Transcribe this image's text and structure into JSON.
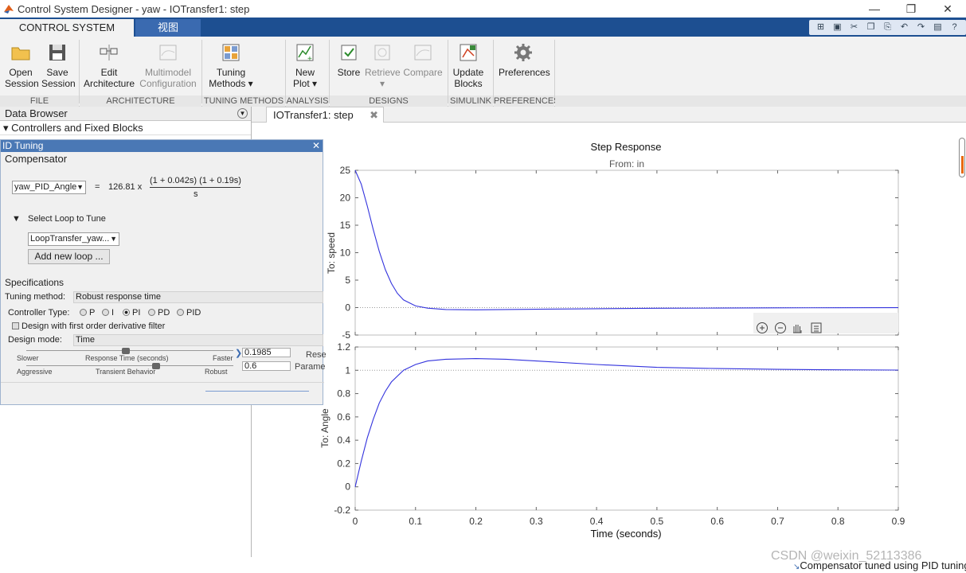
{
  "window": {
    "title": "Control System Designer - yaw - IOTransfer1: step",
    "controls": [
      "—",
      "❐",
      "✕"
    ]
  },
  "tabs": {
    "active": "CONTROL SYSTEM",
    "inactive": "视图"
  },
  "quick_access": [
    "⊞",
    "▣",
    "✂",
    "❐",
    "⎘",
    "↶",
    "↷",
    "▤",
    "?"
  ],
  "ribbon": {
    "open_session": "Open\nSession",
    "save_session": "Save\nSession",
    "edit_architecture": "Edit\nArchitecture",
    "multimodel_configuration": "Multimodel\nConfiguration",
    "tuning_methods": "Tuning\nMethods ▾",
    "new_plot": "New\nPlot ▾",
    "store": "Store",
    "retrieve": "Retrieve\n▾",
    "compare": "Compare",
    "update_blocks": "Update\nBlocks",
    "preferences": "Preferences",
    "groups": [
      "FILE",
      "ARCHITECTURE",
      "TUNING METHODS",
      "ANALYSIS",
      "DESIGNS",
      "SIMULINK",
      "PREFERENCES"
    ]
  },
  "data_browser": {
    "header": "Data Browser",
    "section": "▾ Controllers and Fixed Blocks"
  },
  "document_tab": {
    "label": "IOTransfer1: step",
    "close": "✖"
  },
  "pid_panel": {
    "title": "ID Tuning",
    "compensator_label": "Compensator",
    "compensator_select": "yaw_PID_Angle",
    "equals": "=",
    "gain": "126.81 x",
    "numerator": "(1 + 0.042s) (1 + 0.19s)",
    "denominator": "s",
    "select_loop_label": "Select Loop to Tune",
    "loop_select": "LoopTransfer_yaw...",
    "add_loop_button": "Add new loop ...",
    "specifications_label": "Specifications",
    "tuning_method_label": "Tuning method:",
    "tuning_method_value": "Robust response time",
    "controller_type_label": "Controller Type:",
    "controller_types": [
      {
        "label": "P",
        "selected": false
      },
      {
        "label": "I",
        "selected": false
      },
      {
        "label": "PI",
        "selected": true
      },
      {
        "label": "PD",
        "selected": false
      },
      {
        "label": "PID",
        "selected": false
      }
    ],
    "derivative_filter_label": "Design with first order derivative filter",
    "design_mode_label": "Design mode:",
    "design_mode_value": "Time",
    "slider1": {
      "left": "Slower",
      "mid": "Response Time (seconds)",
      "right": "Faster",
      "value": "0.1985"
    },
    "slider2": {
      "left": "Aggressive",
      "mid": "Transient Behavior",
      "right": "Robust",
      "value": "0.6"
    },
    "reset_label": "Rese",
    "param_label": "Parame"
  },
  "plot": {
    "title": "Step Response",
    "subtitle": "From: in",
    "xlabel": "Time (seconds)",
    "top_ylabel": "To: speed",
    "bottom_ylabel": "To: Angle",
    "plot_toolbar_icons": [
      "zoom-in",
      "zoom-out",
      "pan",
      "legend"
    ]
  },
  "chart_data": [
    {
      "type": "line",
      "title": "Step Response",
      "subtitle": "From: in",
      "ylabel": "To: speed",
      "xlabel": "",
      "x_ticks": [
        0,
        0.1,
        0.2,
        0.3,
        0.4,
        0.5,
        0.6,
        0.7,
        0.8,
        0.9
      ],
      "y_ticks": [
        -5,
        0,
        5,
        10,
        15,
        20,
        25
      ],
      "xlim": [
        0,
        0.9
      ],
      "ylim": [
        -5,
        25
      ],
      "reference_line": 0,
      "x": [
        0,
        0.01,
        0.02,
        0.03,
        0.04,
        0.05,
        0.06,
        0.07,
        0.08,
        0.1,
        0.12,
        0.15,
        0.2,
        0.3,
        0.4,
        0.5,
        0.6,
        0.7,
        0.8,
        0.9
      ],
      "y": [
        25,
        22.5,
        18.5,
        14.2,
        10.2,
        6.9,
        4.4,
        2.6,
        1.4,
        0.3,
        -0.1,
        -0.35,
        -0.4,
        -0.3,
        -0.2,
        -0.12,
        -0.08,
        -0.05,
        -0.03,
        -0.02
      ]
    },
    {
      "type": "line",
      "ylabel": "To: Angle",
      "xlabel": "Time (seconds)",
      "x_ticks": [
        0,
        0.1,
        0.2,
        0.3,
        0.4,
        0.5,
        0.6,
        0.7,
        0.8,
        0.9
      ],
      "y_ticks": [
        -0.2,
        0,
        0.2,
        0.4,
        0.6,
        0.8,
        1,
        1.2
      ],
      "xlim": [
        0,
        0.9
      ],
      "ylim": [
        -0.2,
        1.2
      ],
      "reference_line": 1,
      "x": [
        0,
        0.01,
        0.02,
        0.03,
        0.04,
        0.05,
        0.06,
        0.08,
        0.1,
        0.12,
        0.15,
        0.2,
        0.25,
        0.3,
        0.4,
        0.5,
        0.6,
        0.7,
        0.8,
        0.9
      ],
      "y": [
        0,
        0.22,
        0.42,
        0.58,
        0.72,
        0.82,
        0.9,
        1.0,
        1.05,
        1.08,
        1.095,
        1.1,
        1.095,
        1.08,
        1.05,
        1.025,
        1.015,
        1.008,
        1.004,
        1.002
      ]
    }
  ],
  "status": {
    "watermark": "CSDN @weixin_52113386",
    "message": "Compensator tuned using PID tuning."
  },
  "colors": {
    "accent": "#1d4f91",
    "curve": "#3333dd"
  }
}
